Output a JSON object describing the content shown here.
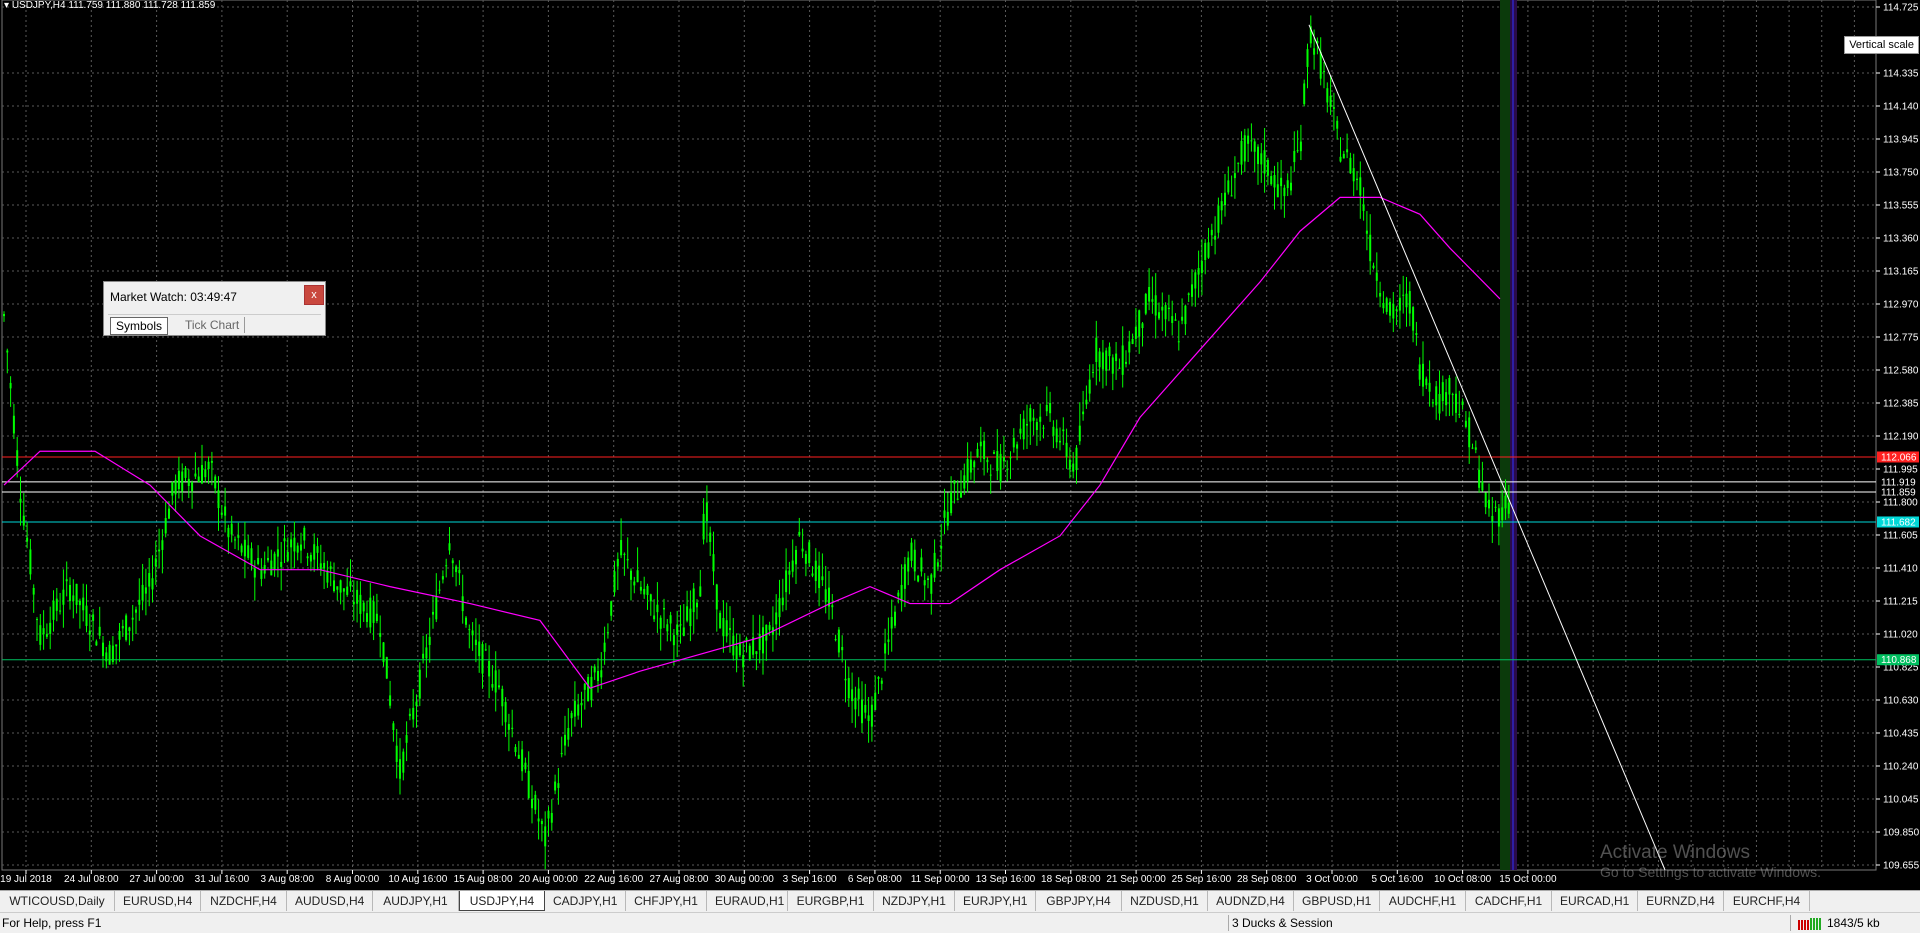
{
  "chart": {
    "header": "USDJPY,H4  111.759 111.880 111.728 111.859",
    "vertical_scale_tooltip": "Vertical scale",
    "price_levels": [
      "114.725",
      "114.335",
      "114.140",
      "113.945",
      "113.750",
      "113.555",
      "113.360",
      "113.165",
      "112.970",
      "112.775",
      "112.580",
      "112.385",
      "112.190",
      "111.995",
      "111.800",
      "111.605",
      "111.410",
      "111.215",
      "111.020",
      "110.825",
      "110.630",
      "110.435",
      "110.240",
      "110.045",
      "109.850",
      "109.655"
    ],
    "highlight_labels": [
      {
        "text": "112.066",
        "color": "#ff2020",
        "price": 112.066
      },
      {
        "text": "111.919",
        "color": "#ffffff",
        "price": 111.919
      },
      {
        "text": "111.859",
        "color": "#ffffff",
        "price": 111.859
      },
      {
        "text": "111.682",
        "color": "#00d8d8",
        "price": 111.682
      },
      {
        "text": "110.868",
        "color": "#00c060",
        "price": 110.868
      }
    ],
    "time_labels": [
      "19 Jul 2018",
      "24 Jul 08:00",
      "27 Jul 00:00",
      "31 Jul 16:00",
      "3 Aug 08:00",
      "8 Aug 00:00",
      "10 Aug 16:00",
      "15 Aug 08:00",
      "20 Aug 00:00",
      "22 Aug 16:00",
      "27 Aug 08:00",
      "30 Aug 00:00",
      "3 Sep 16:00",
      "6 Sep 08:00",
      "11 Sep 00:00",
      "13 Sep 16:00",
      "18 Sep 08:00",
      "21 Sep 00:00",
      "25 Sep 16:00",
      "28 Sep 08:00",
      "3 Oct 00:00",
      "5 Oct 16:00",
      "10 Oct 08:00",
      "15 Oct 00:00"
    ],
    "colors": {
      "candles": "#00ff00",
      "moving_average": "#ff00ff",
      "trendline": "#ffffff",
      "grid": "#5a5a5a"
    },
    "watermark": {
      "line1": "Activate Windows",
      "line2": "Go to Settings to activate Windows."
    }
  },
  "market_watch": {
    "title": "Market Watch: 03:49:47",
    "close_label": "x",
    "tabs": [
      "Symbols",
      "Tick Chart"
    ]
  },
  "tabs": [
    "WTICOUSD,Daily",
    "EURUSD,H4",
    "NZDCHF,H4",
    "AUDUSD,H4",
    "AUDJPY,H1",
    "USDJPY,H4",
    "CADJPY,H1",
    "CHFJPY,H1",
    "EURAUD,H1",
    "EURGBP,H1",
    "NZDJPY,H1",
    "EURJPY,H1",
    "GBPJPY,H4",
    "NZDUSD,H1",
    "AUDNZD,H4",
    "GBPUSD,H1",
    "AUDCHF,H1",
    "CADCHF,H1",
    "EURCAD,H1",
    "EURNZD,H4",
    "EURCHF,H4"
  ],
  "active_tab": "USDJPY,H4",
  "status": {
    "help": "For Help, press F1",
    "profile": "3 Ducks & Session",
    "traffic": "1843/5 kb"
  }
}
